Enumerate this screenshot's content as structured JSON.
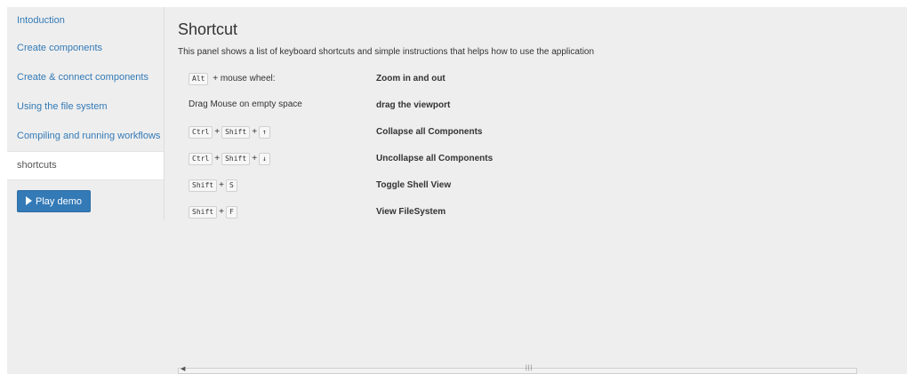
{
  "sidebar": {
    "items": [
      {
        "label": "Intoduction"
      },
      {
        "label": "Create components"
      },
      {
        "label": "Create & connect components"
      },
      {
        "label": "Using the file system"
      },
      {
        "label": "Compiling and running workflows"
      },
      {
        "label": "shortcuts",
        "active": true
      }
    ],
    "play_button": {
      "label": "Play demo",
      "icon": "play-icon"
    }
  },
  "main": {
    "title": "Shortcut",
    "description": "This panel shows a list of keyboard shortcuts and simple instructions that helps how to use the application",
    "shortcuts": [
      {
        "keys": [
          "Alt"
        ],
        "suffix": "+ mouse wheel:",
        "action": "Zoom in and out"
      },
      {
        "text": "Drag Mouse on empty space",
        "action": "drag the viewport"
      },
      {
        "keys": [
          "Ctrl",
          "Shift",
          "↑"
        ],
        "action": "Collapse all Components"
      },
      {
        "keys": [
          "Ctrl",
          "Shift",
          "↓"
        ],
        "action": "Uncollapse all Components"
      },
      {
        "keys": [
          "Shift",
          "S"
        ],
        "action": "Toggle Shell View"
      },
      {
        "keys": [
          "Shift",
          "F"
        ],
        "action": "View FileSystem"
      }
    ]
  },
  "scrollbar": {
    "arrow": "◀",
    "grip": "|||"
  },
  "colors": {
    "link": "#337ab7",
    "button": "#337ab7",
    "panel_bg": "#eeeeee"
  }
}
